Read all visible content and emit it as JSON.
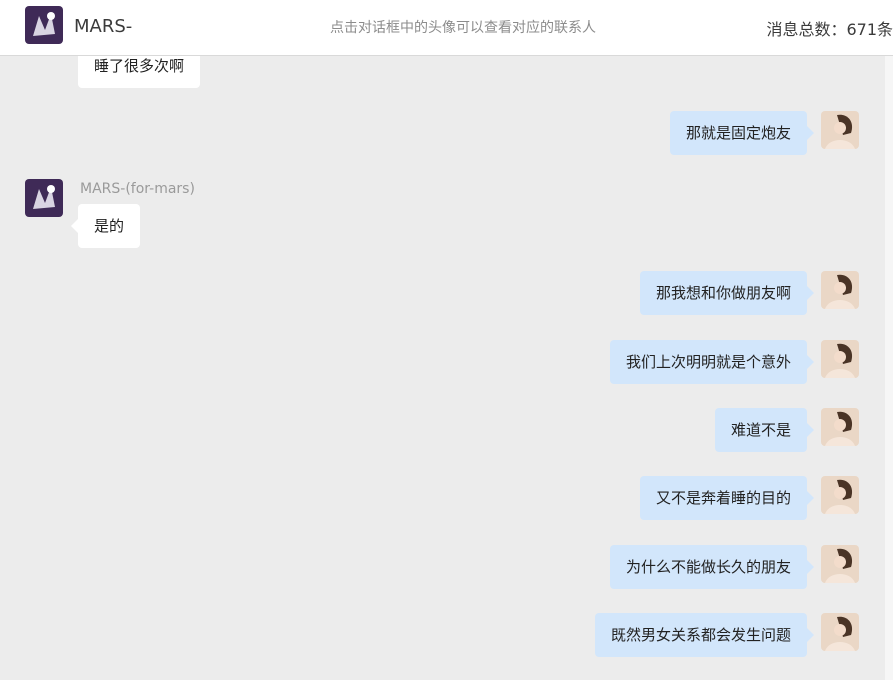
{
  "header": {
    "contact_name": "MARS-",
    "tip": "点击对话框中的头像可以查看对应的联系人",
    "message_count": "消息总数：671条"
  },
  "icons": {
    "contact_avatar": "contact-avatar-icon",
    "self_avatar": "self-avatar-icon"
  },
  "colors": {
    "background": "#ececec",
    "incoming_bubble": "#ffffff",
    "outgoing_bubble": "#d2e6fb"
  },
  "messages": [
    {
      "side": "incoming",
      "text": "睡了很多次啊"
    },
    {
      "side": "outgoing",
      "text": "那就是固定炮友"
    },
    {
      "side": "incoming",
      "sender": "MARS-(for-mars)",
      "text": "是的"
    },
    {
      "side": "outgoing",
      "text": "那我想和你做朋友啊"
    },
    {
      "side": "outgoing",
      "text": "我们上次明明就是个意外"
    },
    {
      "side": "outgoing",
      "text": "难道不是"
    },
    {
      "side": "outgoing",
      "text": "又不是奔着睡的目的"
    },
    {
      "side": "outgoing",
      "text": "为什么不能做长久的朋友"
    },
    {
      "side": "outgoing",
      "text": "既然男女关系都会发生问题"
    }
  ]
}
